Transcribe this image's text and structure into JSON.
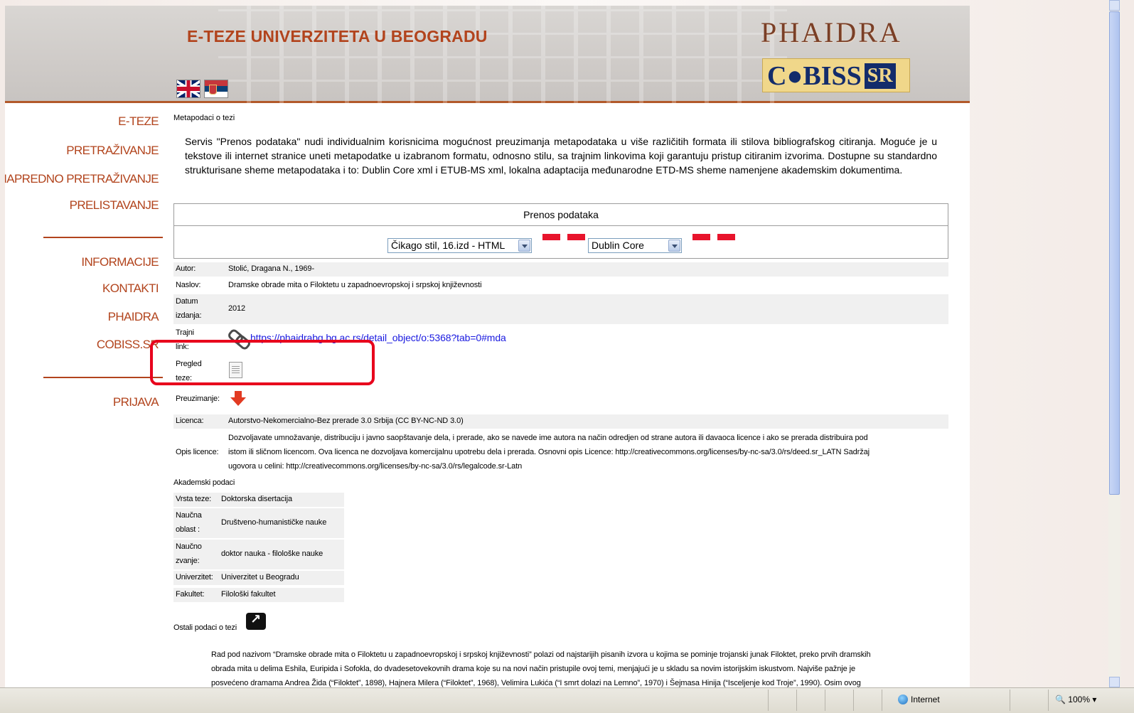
{
  "header": {
    "site_title": "E-TEZE UNIVERZITETA U BEOGRADU",
    "logo_phaidra": "PHAIDRA",
    "logo_cobiss": "C●BISS",
    "logo_cobiss_sr": "SR",
    "languages": [
      "english-flag",
      "serbian-flag"
    ]
  },
  "nav": {
    "items": [
      "E-TEZE",
      "PRETRAŽIVANJE",
      "NAPREDNO PRETRAŽIVANJE",
      "PRELISTAVANJE",
      "INFORMACIJE",
      "KONTAKTI",
      "PHAIDRA",
      "COBISS.SR",
      "PRIJAVA"
    ]
  },
  "main": {
    "breadcrumb": "Metapodaci o tezi",
    "intro": "Servis \"Prenos podataka\" nudi individualnim korisnicima mogućnost preuzimanja metapodataka u više različitih formata ili stilova bibliografskog citiranja. Moguće je u tekstove ili internet stranice uneti metapodatke u izabranom formatu, odnosno stilu, sa trajnim linkovima koji garantuju pristup citiranim izvorima. Dostupne su standardno strukturisane sheme metapodataka i to: Dublin Core xml i ETUB-MS xml, lokalna adaptacija međunarodne ETD-MS sheme namenjene akademskim dokumentima.",
    "export_title": "Prenos podataka",
    "citation_select": "Čikago stil, 16.izd - HTML",
    "schema_select": "Dublin Core",
    "fields": {
      "autor_label": "Autor:",
      "autor": "Stolić, Dragana N., 1969-",
      "naslov_label": "Naslov:",
      "naslov": "Dramske obrade mita o Filoktetu u zapadnoevropskoj i srpskoj književnosti",
      "datum_label_1": "Datum",
      "datum_label_2": "izdanja:",
      "datum": "2012",
      "link_label_1": "Trajni",
      "link_label_2": "link:",
      "link": "https://phaidrabg.bg.ac.rs/detail_object/o:5368?tab=0#mda",
      "pregled_label_1": "Pregled",
      "pregled_label_2": "teze:",
      "preuzimanje_label": "Preuzimanje:",
      "licenca_label": "Licenca:",
      "licenca": "Autorstvo-Nekomercialno-Bez prerade 3.0 Srbija (CC BY-NC-ND 3.0)",
      "opis_label": "Opis licence:",
      "opis_1": "Dozvoljavate umnožavanje, distribuciju i javno saopštavanje dela, i prerade, ako se navede ime autora na način odredjen od strane autora ili davaoca licence i ako se prerada distribuira pod",
      "opis_2": "istom ili sličnom licencom. Ova licenca ne dozvoljava komercijalnu upotrebu dela i prerada. Osnovni opis Licence: http://creativecommons.org/licenses/by-nc-sa/3.0/rs/deed.sr_LATN Sadržaj",
      "opis_3": "ugovora u celini: http://creativecommons.org/licenses/by-nc-sa/3.0/rs/legalcode.sr-Latn"
    },
    "academic": {
      "heading": "Akademski podaci",
      "vrsta_label": "Vrsta teze:",
      "vrsta": "Doktorska disertacija",
      "oblast_label_1": "Naučna",
      "oblast_label_2": "oblast :",
      "oblast": "Društveno-humanističke nauke",
      "zvanje_label_1": "Naučno",
      "zvanje_label_2": "zvanje:",
      "zvanje": "doktor nauka - filološke nauke",
      "univerzitet_label": "Univerzitet:",
      "univerzitet": "Univerzitet u Beogradu",
      "fakultet_label": "Fakultet:",
      "fakultet": "Filološki fakultet"
    },
    "other_heading": "Ostali podaci o tezi",
    "abstract_1": "Rad pod nazivom “Dramske obrade mita o Filoktetu u zapadnoevropskoj i srpskoj književnosti” polazi od najstarijih pisanih izvora u kojima se pominje trojanski junak Filoktet, preko prvih dramskih",
    "abstract_2": "obrada mita u delima Eshila, Euripida i Sofokla, do dvadesetovekovnih drama koje su na novi način pristupile ovoj temi, menjajući je u skladu sa novim istorijskim iskustvom. Najviše pažnje je",
    "abstract_3": "posvećeno dramama Andrea Žida (“Filoktet”, 1898), Hajnera Milera (“Filoktet”, 1968), Velimira Lukića (“I smrt dolazi na Lemno”, 1970) i Šejmasa Hinija (“Isceljenje kod Troje”, 1990). Osim ovog"
  },
  "statusbar": {
    "zone": "Internet",
    "zoom": "100%"
  },
  "colors": {
    "accent": "#b2441d",
    "highlight": "#e8001c",
    "link": "#1a1ae0"
  }
}
